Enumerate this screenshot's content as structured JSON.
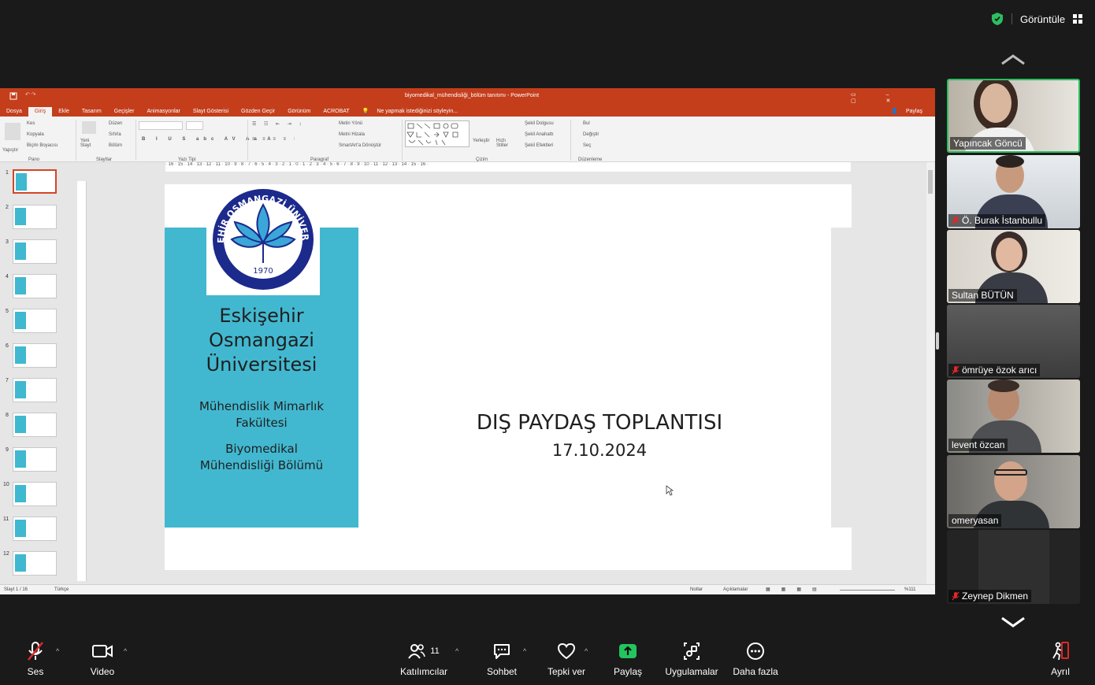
{
  "top_bar": {
    "view_label": "Görüntüle"
  },
  "ppt": {
    "window_title": "biyomedikal_mühendisliği_bölüm tanıtımı - PowerPoint",
    "tabs": [
      "Dosya",
      "Giriş",
      "Ekle",
      "Tasarım",
      "Geçişler",
      "Animasyonlar",
      "Slayt Gösterisi",
      "Gözden Geçir",
      "Görünüm",
      "ACROBAT"
    ],
    "tell_me": "Ne yapmak istediğinizi söyleyin...",
    "share": "Paylaş",
    "ribbon": {
      "paste": "Yapıştır",
      "cut": "Kes",
      "copy": "Kopyala",
      "format_painter": "Biçim Boyacısı",
      "group_clipboard": "Pano",
      "new_slide": "Yeni Slayt",
      "layout": "Düzen",
      "reset": "Sıfırla",
      "section": "Bölüm",
      "group_slides": "Slaytlar",
      "group_font": "Yazı Tipi",
      "text_direction": "Metin Yönü",
      "align_text": "Metni Hizala",
      "smartart": "SmartArt'a Dönüştür",
      "group_paragraph": "Paragraf",
      "arrange": "Yerleştir",
      "quick_styles": "Hızlı Stiller",
      "shape_fill": "Şekil Dolgusu",
      "shape_outline": "Şekil Anahattı",
      "shape_effects": "Şekil Efektleri",
      "group_drawing": "Çizim",
      "find": "Bul",
      "replace": "Değiştir",
      "select": "Seç",
      "group_editing": "Düzenleme"
    },
    "thumb_numbers": [
      "1",
      "2",
      "3",
      "4",
      "5",
      "6",
      "7",
      "8",
      "9",
      "10",
      "11",
      "12"
    ],
    "status_slide": "Slayt 1 / 16",
    "status_lang": "Türkçe",
    "status_notes": "Notlar",
    "status_comments": "Açıklamalar",
    "status_zoom": "%111"
  },
  "slide": {
    "logo_top_text": "ESKİŞEHİR OSMANGAZİ ÜNİVERSİTESİ",
    "logo_year": "1970",
    "uni_line1": "Eskişehir",
    "uni_line2": "Osmangazi",
    "uni_line3": "Üniversitesi",
    "faculty_line1": "Mühendislik Mimarlık",
    "faculty_line2": "Fakültesi",
    "dept_line1": "Biyomedikal",
    "dept_line2": "Mühendisliği Bölümü",
    "meeting_title": "DIŞ PAYDAŞ TOPLANTISI",
    "meeting_date": "17.10.2024"
  },
  "participants": [
    {
      "name": "Yapıncak Göncü",
      "muted": false
    },
    {
      "name": "Ö. Burak İstanbullu",
      "muted": true
    },
    {
      "name": "Sultan BÜTÜN",
      "muted": false
    },
    {
      "name": "ömrüye özok arıcı",
      "muted": true
    },
    {
      "name": "levent özcan",
      "muted": false
    },
    {
      "name": "omeryasan",
      "muted": false
    },
    {
      "name": "Zeynep Dikmen",
      "muted": true
    }
  ],
  "toolbar": {
    "audio": "Ses",
    "video": "Video",
    "participants": "Katılımcılar",
    "participant_count": "11",
    "chat": "Sohbet",
    "reactions": "Tepki ver",
    "share": "Paylaş",
    "apps": "Uygulamalar",
    "more": "Daha fazla",
    "leave": "Ayrıl"
  },
  "colors": {
    "ppt_accent": "#c43e1c",
    "slide_band": "#42b8d0",
    "share_green": "#22c55e",
    "active_border": "#2dbe60"
  }
}
